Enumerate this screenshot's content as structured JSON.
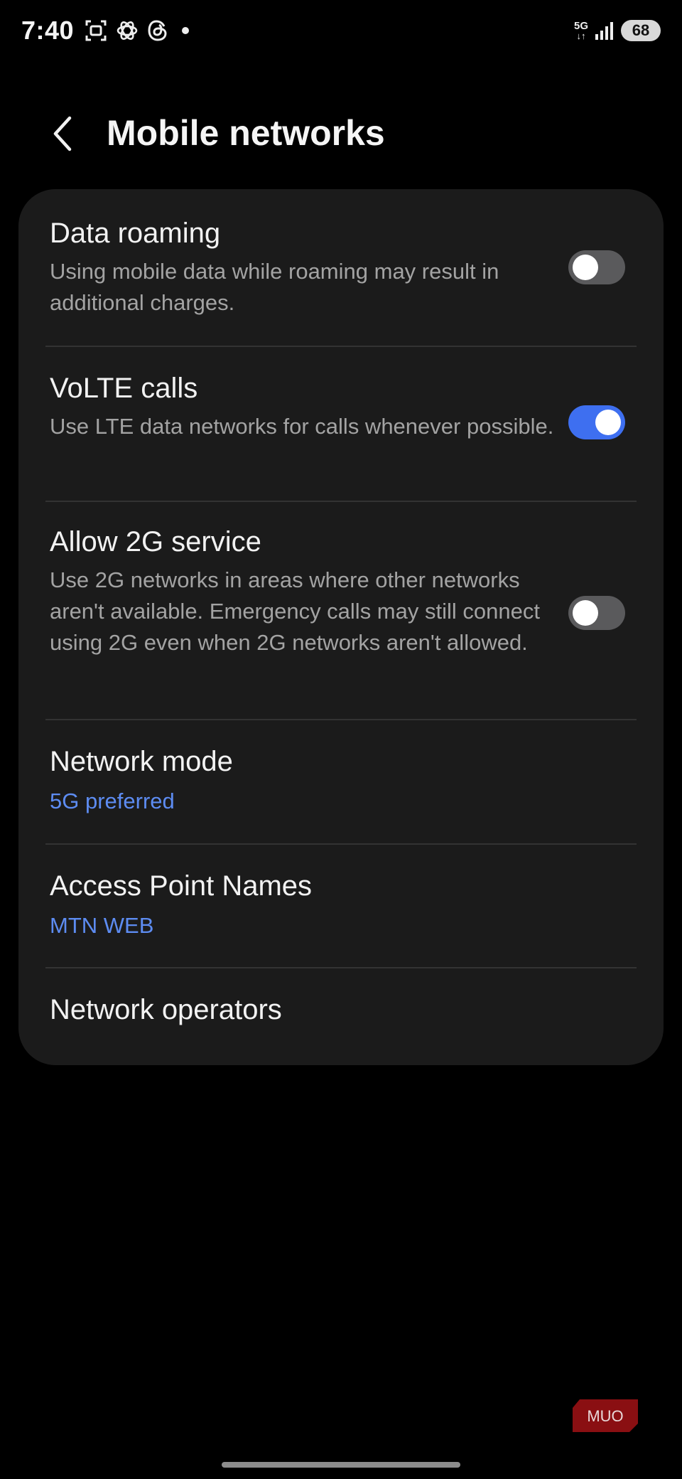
{
  "status_bar": {
    "time": "7:40",
    "network_type": "5G",
    "network_arrows": "↓↑",
    "battery": "68",
    "icons": [
      "screenshot-icon",
      "chatgpt-icon",
      "threads-icon",
      "notification-dot-icon",
      "signal-icon"
    ]
  },
  "header": {
    "title": "Mobile networks",
    "back_icon": "chevron-left-icon"
  },
  "settings": {
    "data_roaming": {
      "title": "Data roaming",
      "description": "Using mobile data while roaming may result in additional charges.",
      "enabled": false
    },
    "volte_calls": {
      "title": "VoLTE calls",
      "description": "Use LTE data networks for calls whenever possible.",
      "enabled": true
    },
    "allow_2g": {
      "title": "Allow 2G service",
      "description": "Use 2G networks in areas where other networks aren't available. Emergency calls may still connect using 2G even when 2G networks aren't allowed.",
      "enabled": false
    },
    "network_mode": {
      "title": "Network mode",
      "value": "5G preferred"
    },
    "access_point_names": {
      "title": "Access Point Names",
      "value": "MTN WEB"
    },
    "network_operators": {
      "title": "Network operators"
    }
  },
  "colors": {
    "background": "#000000",
    "card": "#1b1b1b",
    "accent": "#3e6ff0",
    "link": "#5d8cf2",
    "toggle_off": "#5a5a5c"
  },
  "watermark": {
    "text": "MUO"
  }
}
